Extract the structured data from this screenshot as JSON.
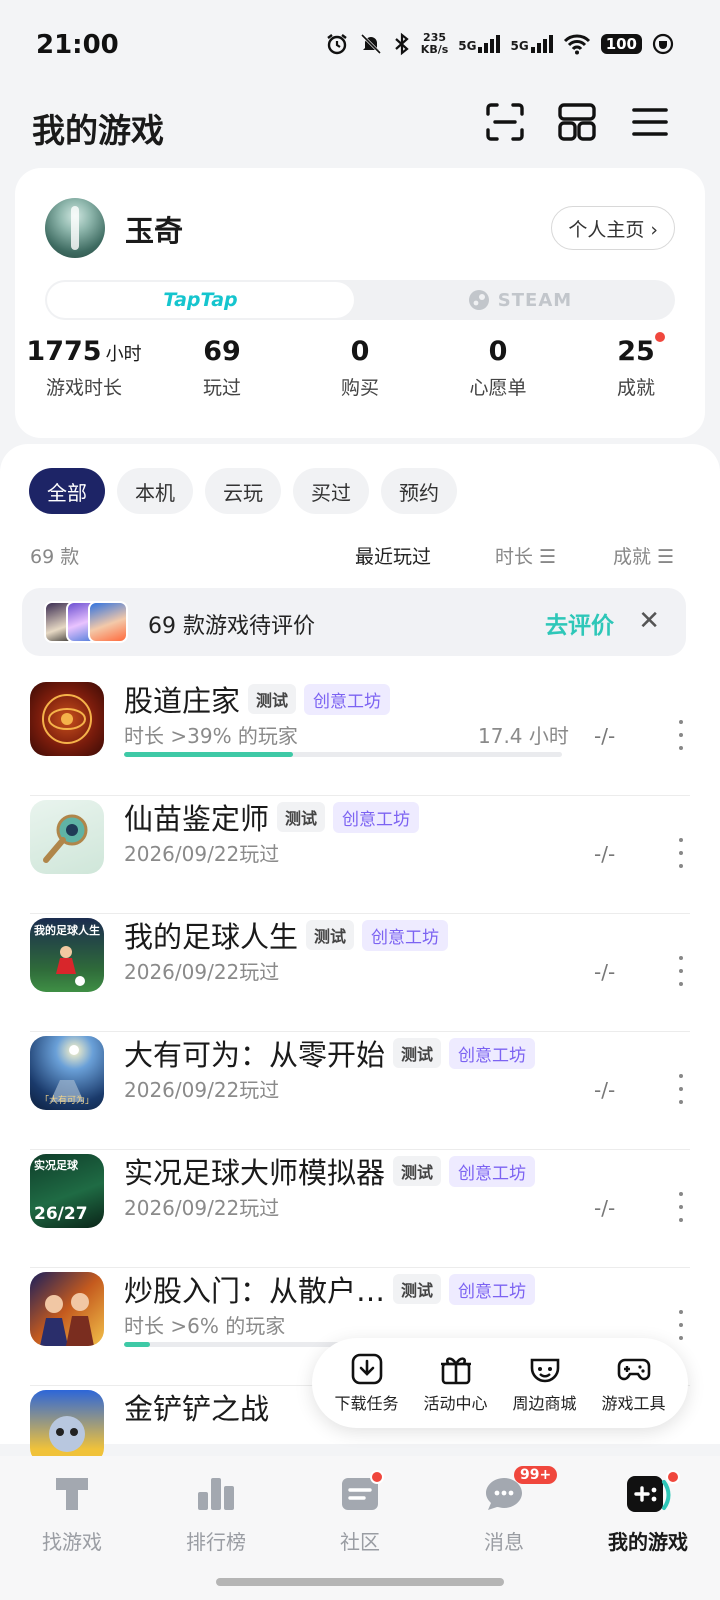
{
  "status": {
    "time": "21:00",
    "speed_value": "235",
    "speed_unit": "KB/s",
    "net1": "5G",
    "net2": "5G",
    "battery": "100"
  },
  "header": {
    "title": "我的游戏"
  },
  "profile": {
    "username": "玉奇",
    "homepage_label": "个人主页 ›",
    "platforms": {
      "taptap": "TapTap",
      "steam": "STEAM"
    },
    "stats": [
      {
        "value": "1775",
        "unit": "小时",
        "label": "游戏时长"
      },
      {
        "value": "69",
        "unit": "",
        "label": "玩过"
      },
      {
        "value": "0",
        "unit": "",
        "label": "购买"
      },
      {
        "value": "0",
        "unit": "",
        "label": "心愿单"
      },
      {
        "value": "25",
        "unit": "",
        "label": "成就"
      }
    ]
  },
  "filters": [
    "全部",
    "本机",
    "云玩",
    "买过",
    "预约"
  ],
  "sort": {
    "count": "69 款",
    "recent": "最近玩过",
    "duration": "时长 ☰",
    "achievement": "成就 ☰"
  },
  "review": {
    "text": "69 款游戏待评价",
    "action": "去评价",
    "close": "✕"
  },
  "tags": {
    "test": "测试",
    "workshop": "创意工坊"
  },
  "games": [
    {
      "name": "股道庄家",
      "sub": "时长 >39% 的玩家",
      "hours": "17.4 小时",
      "ach": "-/-",
      "progress": 0.385
    },
    {
      "name": "仙苗鉴定师",
      "sub": "2026/09/22玩过",
      "ach": "-/-"
    },
    {
      "name": "我的足球人生",
      "sub": "2026/09/22玩过",
      "ach": "-/-",
      "icon_text": "我的足球人生"
    },
    {
      "name": "大有可为：从零开始",
      "sub": "2026/09/22玩过",
      "ach": "-/-",
      "icon_text": "「大有可为」"
    },
    {
      "name": "实况足球大师模拟器",
      "sub": "2026/09/22玩过",
      "ach": "-/-",
      "icon_text": "实况足球",
      "icon_text2": "26/27"
    },
    {
      "name": "炒股入门：从散户…",
      "sub": "时长 >6% 的玩家",
      "ach": "",
      "progress": 0.06
    },
    {
      "name": "金铲铲之战",
      "sub": "",
      "ach": ""
    }
  ],
  "tools": [
    "下载任务",
    "活动中心",
    "周边商城",
    "游戏工具"
  ],
  "nav": [
    {
      "label": "找游戏"
    },
    {
      "label": "排行榜"
    },
    {
      "label": "社区"
    },
    {
      "label": "消息",
      "badge": "99+"
    },
    {
      "label": "我的游戏"
    }
  ],
  "colors": {
    "accent_navy": "#1d2466",
    "teal": "#2ec7b8",
    "purple": "#7c63f2",
    "red": "#f0473d"
  }
}
